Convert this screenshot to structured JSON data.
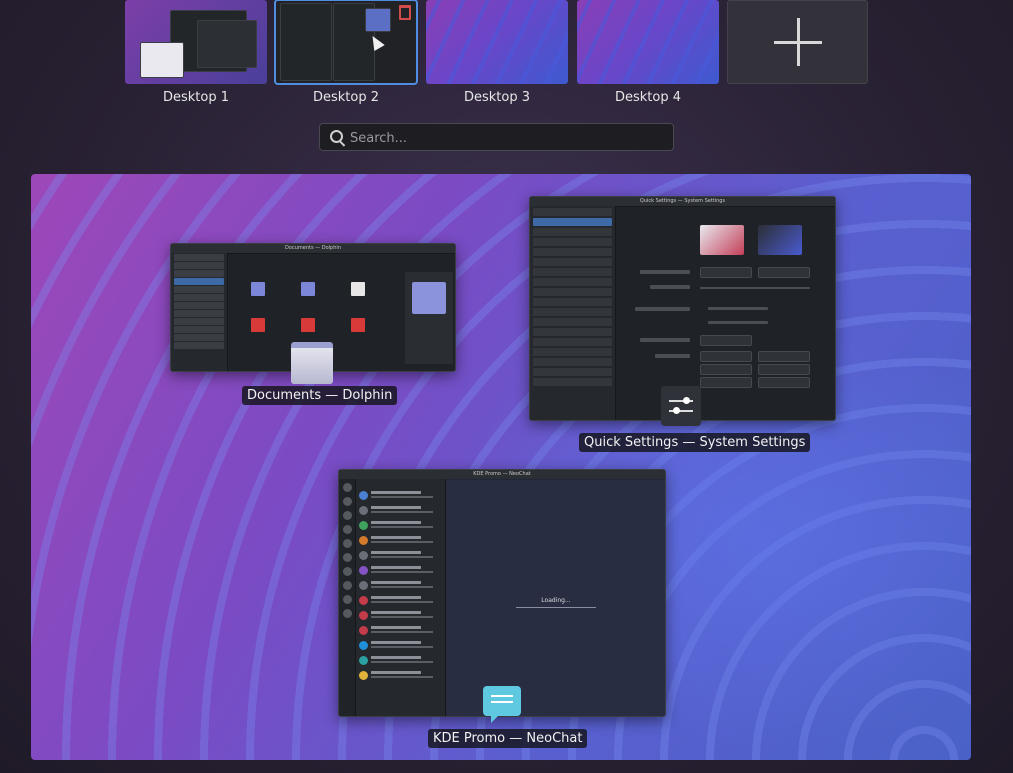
{
  "desktops": [
    {
      "label": "Desktop 1"
    },
    {
      "label": "Desktop 2"
    },
    {
      "label": "Desktop 3"
    },
    {
      "label": "Desktop 4"
    }
  ],
  "add_desktop": {
    "icon": "plus-icon"
  },
  "search": {
    "placeholder": "Search...",
    "value": ""
  },
  "windows": [
    {
      "caption": "Documents — Dolphin",
      "title": "Documents — Dolphin",
      "icon": "folder-icon"
    },
    {
      "caption": "Quick Settings — System Settings",
      "title": "Quick Settings — System Settings",
      "icon": "settings-sliders-icon"
    },
    {
      "caption": "KDE Promo — NeoChat",
      "title": "KDE Promo — NeoChat",
      "icon": "chat-bubble-icon",
      "loading_text": "Loading..."
    }
  ],
  "colors": {
    "accent": "#3d6aa6",
    "caption_bg": "#14141a"
  }
}
